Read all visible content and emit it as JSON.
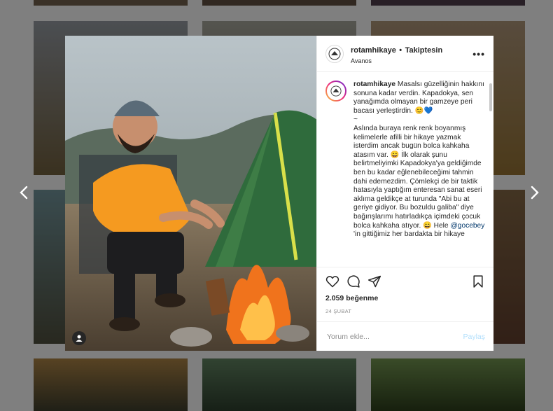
{
  "nav": {
    "prev_label": "‹",
    "next_label": "›"
  },
  "post": {
    "username": "rotamhikaye",
    "separator": "•",
    "follow_status": "Takiptesin",
    "location": "Avanos",
    "more_label": "•••",
    "caption_user": "rotamhikaye",
    "caption_p1": "Masalsı güzelliğinin hakkını sonuna kadar verdin. Kapadokya, sen yanağımda olmayan bir gamzeye peri bacası yerleştirdin. 😊💙",
    "caption_tilde": "~",
    "caption_p2": "Aslında buraya renk renk boyanmış kelimelerle afilli bir hikaye yazmak isterdim ancak bugün bolca kahkaha atasım var. 😄 İlk olarak şunu belirtmeliyimki Kapadokya'ya geldiğimde ben bu kadar eğlenebileceğimi tahmin dahi edemezdim. Çömlekçi de bir taktik hatasıyla yaptığım enteresan sanat eseri aklıma geldikçe at turunda \"Abi bu at geriye gidiyor. Bu bozuldu galiba\" diye bağırışlarımı hatırladıkça içimdeki çocuk bolca kahkaha atıyor.",
    "caption_p3_pre": "😄 Hele",
    "caption_mention": "@gocebey",
    "caption_p3_post": "'in gittiğimiz her bardakta bir hikaye",
    "likes": "2.059 beğenme",
    "date": "24 ŞUBAT",
    "comment_placeholder": "Yorum ekle...",
    "post_button": "Paylaş"
  },
  "icons": {
    "like": "heart-icon",
    "comment": "comment-icon",
    "share": "share-icon",
    "save": "bookmark-icon",
    "user_tag": "user-icon"
  },
  "colors": {
    "link": "#00376b",
    "post_button_disabled": "#b2dffc",
    "text": "#262626",
    "muted": "#8e8e8e"
  }
}
